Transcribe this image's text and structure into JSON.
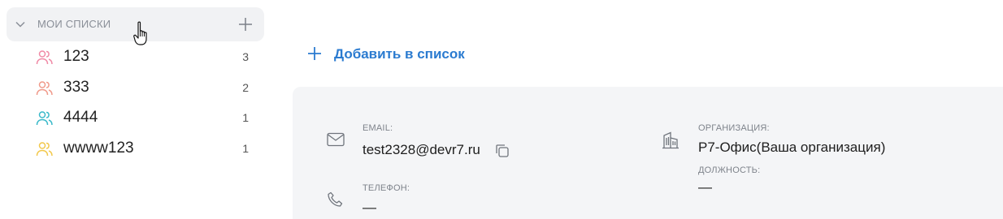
{
  "sidebar": {
    "lists_header": {
      "title": "МОИ СПИСКИ"
    },
    "items": [
      {
        "name": "123",
        "count": "3",
        "color": "#f08aa6"
      },
      {
        "name": "333",
        "count": "2",
        "color": "#f09a8a"
      },
      {
        "name": "4444",
        "count": "1",
        "color": "#3ab9c9"
      },
      {
        "name": "wwww123",
        "count": "1",
        "color": "#f2c84b"
      }
    ]
  },
  "main": {
    "add_to_list_label": "Добавить в список",
    "accent_color": "#2b7bd0",
    "contact": {
      "email_label": "EMAIL:",
      "email_value": "test2328@devr7.ru",
      "phone_label": "ТЕЛЕФОН:",
      "phone_value": "—",
      "org_label": "ОРГАНИЗАЦИЯ:",
      "org_value": "Р7-Офис(Ваша организация)",
      "position_label": "ДОЛЖНОСТЬ:",
      "position_value": "—"
    }
  }
}
